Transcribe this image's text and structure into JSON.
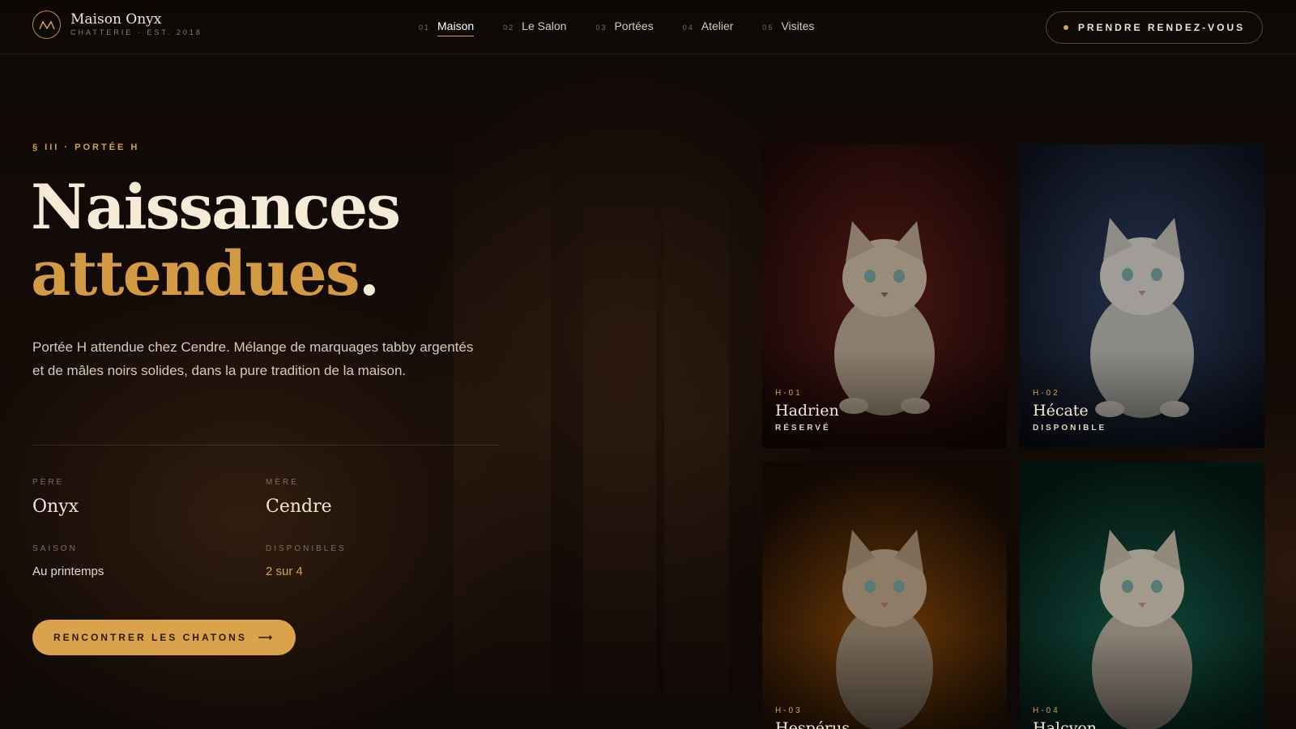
{
  "brand": {
    "name": "Maison Onyx",
    "tagline": "CHATTERIE · EST. 2018"
  },
  "nav": [
    {
      "num": "01",
      "label": "Maison",
      "active": true
    },
    {
      "num": "02",
      "label": "Le Salon"
    },
    {
      "num": "03",
      "label": "Portées"
    },
    {
      "num": "04",
      "label": "Atelier"
    },
    {
      "num": "05",
      "label": "Visites"
    }
  ],
  "header": {
    "cta_label": "PRENDRE RENDEZ-VOUS"
  },
  "hero": {
    "eyebrow": "§ III · PORTÉE H",
    "title_line1": "Naissances",
    "title_line2": "attendues",
    "title_period": ".",
    "lede": "Portée H attendue chez Cendre. Mélange de marquages tabby argentés et de mâles noirs solides, dans la pure tradition de la maison.",
    "meta": {
      "father_label": "PÈRE",
      "father_value": "Onyx",
      "mother_label": "MÈRE",
      "mother_value": "Cendre",
      "season_label": "SAISON",
      "season_value": "Au printemps",
      "available_label": "DISPONIBLES",
      "available_value": "2 sur 4"
    },
    "cta_label": "RENCONTRER LES CHATONS",
    "cta_arrow": "⟶"
  },
  "kittens": [
    {
      "code": "H-01",
      "name": "Hadrien",
      "status": "RÉSERVÉ",
      "bg": "#3a0f0d"
    },
    {
      "code": "H-02",
      "name": "Hécate",
      "status": "DISPONIBLE",
      "bg": "#1b2538"
    },
    {
      "code": "H-03",
      "name": "Hespérus",
      "status": "",
      "bg": "#5a3006"
    },
    {
      "code": "H-04",
      "name": "Halcyon",
      "status": "",
      "bg": "#0b3328"
    }
  ],
  "colors": {
    "accent": "#d6a24e",
    "background": "#0c0705",
    "text": "#efe3cf"
  }
}
